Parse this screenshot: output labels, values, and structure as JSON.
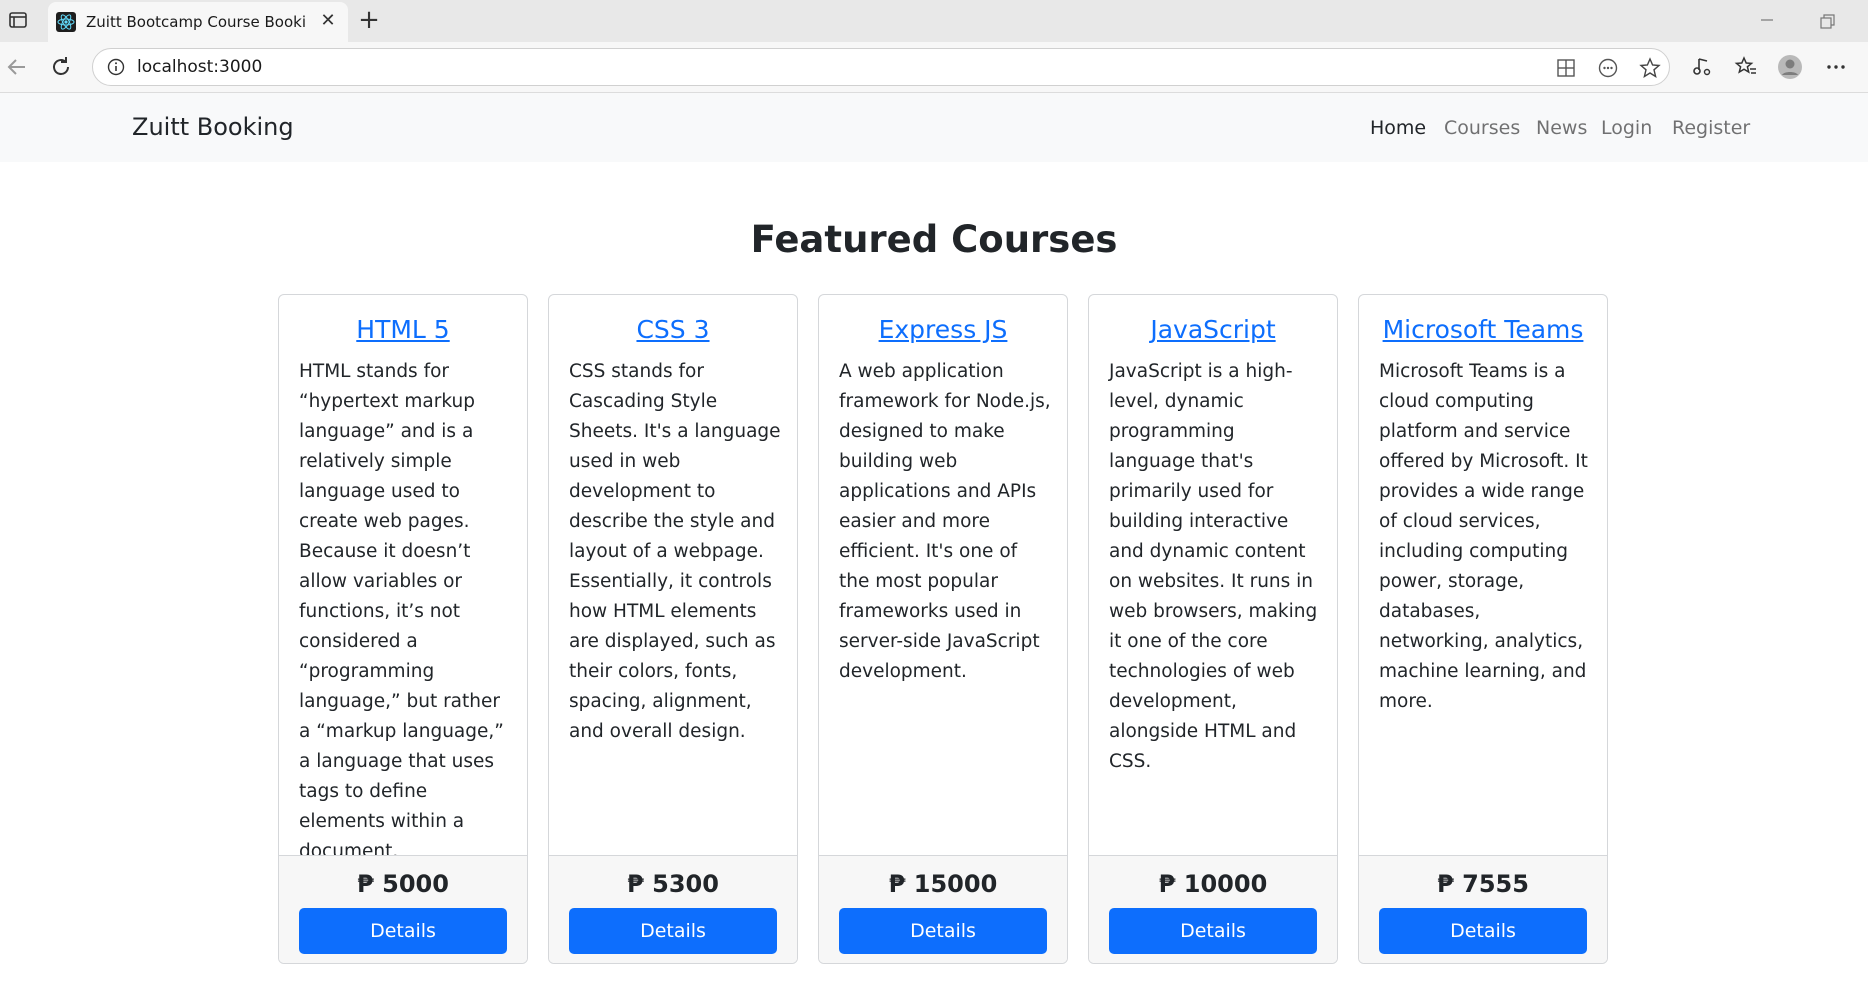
{
  "browser": {
    "tab_title": "Zuitt Bootcamp Course Booking S",
    "tab_close": "✕",
    "new_tab": "+",
    "url": "localhost:3000"
  },
  "navbar": {
    "brand": "Zuitt Booking",
    "links": [
      "Home",
      "Courses",
      "News",
      "Login",
      "Register"
    ],
    "active_link": "Home"
  },
  "page": {
    "title": "Featured Courses"
  },
  "courses": [
    {
      "name": "HTML 5",
      "description": "HTML stands for “hypertext markup language” and is a relatively simple language used to create web pages. Because it doesn’t allow variables or functions, it’s not considered a “programming language,” but rather a “markup language,” a language that uses tags to define elements within a document.",
      "price": "₱ 5000",
      "button": "Details"
    },
    {
      "name": "CSS 3",
      "description": "CSS stands for Cascading Style Sheets. It's a language used in web development to describe the style and layout of a webpage. Essentially, it controls how HTML elements are displayed, such as their colors, fonts, spacing, alignment, and overall design.",
      "price": "₱ 5300",
      "button": "Details"
    },
    {
      "name": "Express JS",
      "description": "A web application framework for Node.js, designed to make building web applications and APIs easier and more efficient. It's one of the most popular frameworks used in server-side JavaScript development.",
      "price": "₱ 15000",
      "button": "Details"
    },
    {
      "name": "JavaScript",
      "description": "JavaScript is a high-level, dynamic programming language that's primarily used for building interactive and dynamic content on websites. It runs in web browsers, making it one of the core technologies of web development, alongside HTML and CSS.",
      "price": "₱ 10000",
      "button": "Details"
    },
    {
      "name": "Microsoft Teams",
      "description": "Microsoft Teams is a cloud computing platform and service offered by Microsoft. It provides a wide range of cloud services, including computing power, storage, databases, networking, analytics, machine learning, and more.",
      "price": "₱ 7555",
      "button": "Details"
    }
  ],
  "colors": {
    "primary": "#0d6efd",
    "navbar_bg": "#f8f9fa",
    "text": "#212529"
  }
}
